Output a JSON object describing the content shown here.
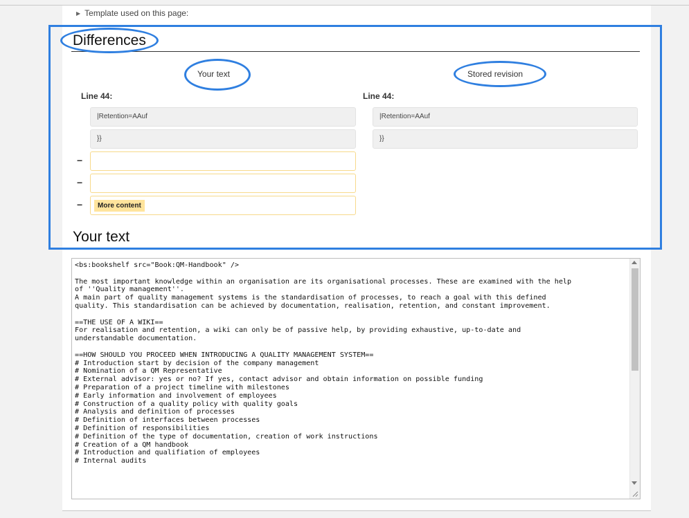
{
  "template_toggle": {
    "arrow_icon": "triangle-right-icon",
    "label": "Template used on this page:"
  },
  "diff": {
    "heading": "Differences",
    "left_column_title": "Your text",
    "right_column_title": "Stored revision",
    "left_line_label": "Line 44:",
    "right_line_label": "Line 44:",
    "context_lines": [
      "|Retention=AAuf",
      "}}"
    ],
    "deleted_lines": [
      "",
      "",
      "More content"
    ],
    "minus_sign": "−",
    "highlight_color": "#2f7fe0"
  },
  "editor": {
    "heading": "Your text",
    "content": "<bs:bookshelf src=\"Book:QM-Handbook\" />\n\nThe most important knowledge within an organisation are its organisational processes. These are examined with the help\nof ''Quality management''.\nA main part of quality management systems is the standardisation of processes, to reach a goal with this defined\nquality. This standardisation can be achieved by documentation, realisation, retention, and constant improvement.\n\n==THE USE OF A WIKI==\nFor realisation and retention, a wiki can only be of passive help, by providing exhaustive, up-to-date and\nunderstandable documentation.\n\n==HOW SHOULD YOU PROCEED WHEN INTRODUCING A QUALITY MANAGEMENT SYSTEM==\n# Introduction start by decision of the company management\n# Nomination of a QM Representative\n# External advisor: yes or no? If yes, contact advisor and obtain information on possible funding\n# Preparation of a project timeline with milestones\n# Early information and involvement of employees\n# Construction of a quality policy with quality goals\n# Analysis and definition of processes\n# Definition of interfaces between processes\n# Definition of responsibilities\n# Definition of the type of documentation, creation of work instructions\n# Creation of a QM handbook\n# Introduction and qualifiation of employees\n# Internal audits"
  }
}
